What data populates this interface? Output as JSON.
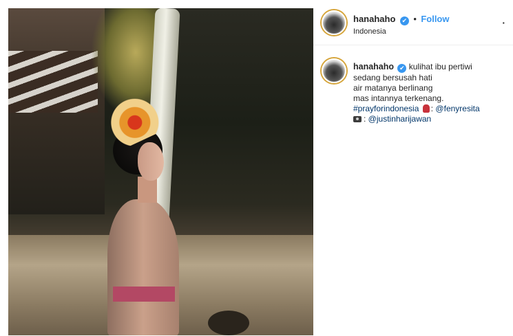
{
  "post": {
    "username": "hanahaho",
    "verified_symbol": "✔",
    "dot": "•",
    "follow_label": "Follow",
    "location": "Indonesia",
    "more_label": "·",
    "caption": {
      "line1": "kulihat ibu pertiwi",
      "line2": "sedang bersusah hati",
      "line3": "air matanya berlinang",
      "line4": "mas intannya terkenang.",
      "hashtag": "#prayforindonesia",
      "mention1_prefix": ": ",
      "mention1": "@fenyresita",
      "mention2_prefix": ": ",
      "mention2": "@justinharijawan"
    }
  }
}
